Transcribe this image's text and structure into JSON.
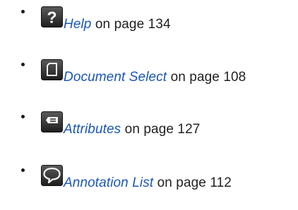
{
  "colors": {
    "link": "#1a57b8",
    "text": "#222222",
    "icon_dark": "#3a3a3a",
    "icon_light": "#f2f2f2"
  },
  "items": [
    {
      "icon": "help-icon",
      "link_text": "Help",
      "page_text": "on page 134"
    },
    {
      "icon": "document-icon",
      "link_text": "Document Select",
      "page_text": "on page 108"
    },
    {
      "icon": "attributes-icon",
      "link_text": "Attributes",
      "page_text": "on page 127"
    },
    {
      "icon": "speech-bubble-icon",
      "link_text": "Annotation List",
      "page_text": "on page 112"
    }
  ]
}
